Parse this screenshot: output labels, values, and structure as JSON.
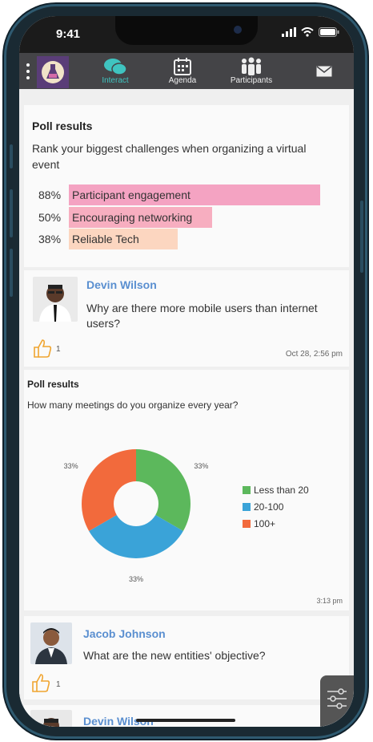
{
  "status": {
    "time": "9:41"
  },
  "nav": {
    "tabs": [
      {
        "label": "Interact",
        "icon": "chat-bubbles-icon"
      },
      {
        "label": "Agenda",
        "icon": "calendar-icon"
      },
      {
        "label": "Participants",
        "icon": "people-icon"
      },
      {
        "label": "",
        "icon": "mail-icon"
      }
    ],
    "active_color": "#3fc4c0"
  },
  "poll1": {
    "title": "Poll results",
    "question": "Rank your biggest challenges when organizing a virtual event",
    "bars": [
      {
        "pct": "88%",
        "label": "Participant engagement",
        "value": 0.88,
        "color": "#f4a3c2"
      },
      {
        "pct": "50%",
        "label": "Encouraging networking",
        "value": 0.5,
        "color": "#f7aec0"
      },
      {
        "pct": "38%",
        "label": "Reliable Tech",
        "value": 0.38,
        "color": "#fcd6c0"
      }
    ]
  },
  "post1": {
    "user": "Devin Wilson",
    "message": "Why are there more mobile users than internet users?",
    "likes": "1",
    "timestamp": "Oct 28, 2:56 pm"
  },
  "poll2": {
    "title": "Poll results",
    "question": "How many meetings do you organize every year?",
    "timestamp": "3:13 pm"
  },
  "chart_data": {
    "type": "pie",
    "categories": [
      "Less than 20",
      "20-100",
      "100+"
    ],
    "values": [
      33,
      33,
      33
    ],
    "value_labels": [
      "33%",
      "33%",
      "33%"
    ],
    "colors": [
      "#5cb85c",
      "#3aa3d8",
      "#f26a3c"
    ],
    "legend": "right"
  },
  "post2": {
    "user": "Jacob Johnson",
    "message": "What are the new entities' objective?",
    "likes": "1"
  },
  "post3": {
    "user": "Devin Wilson"
  }
}
